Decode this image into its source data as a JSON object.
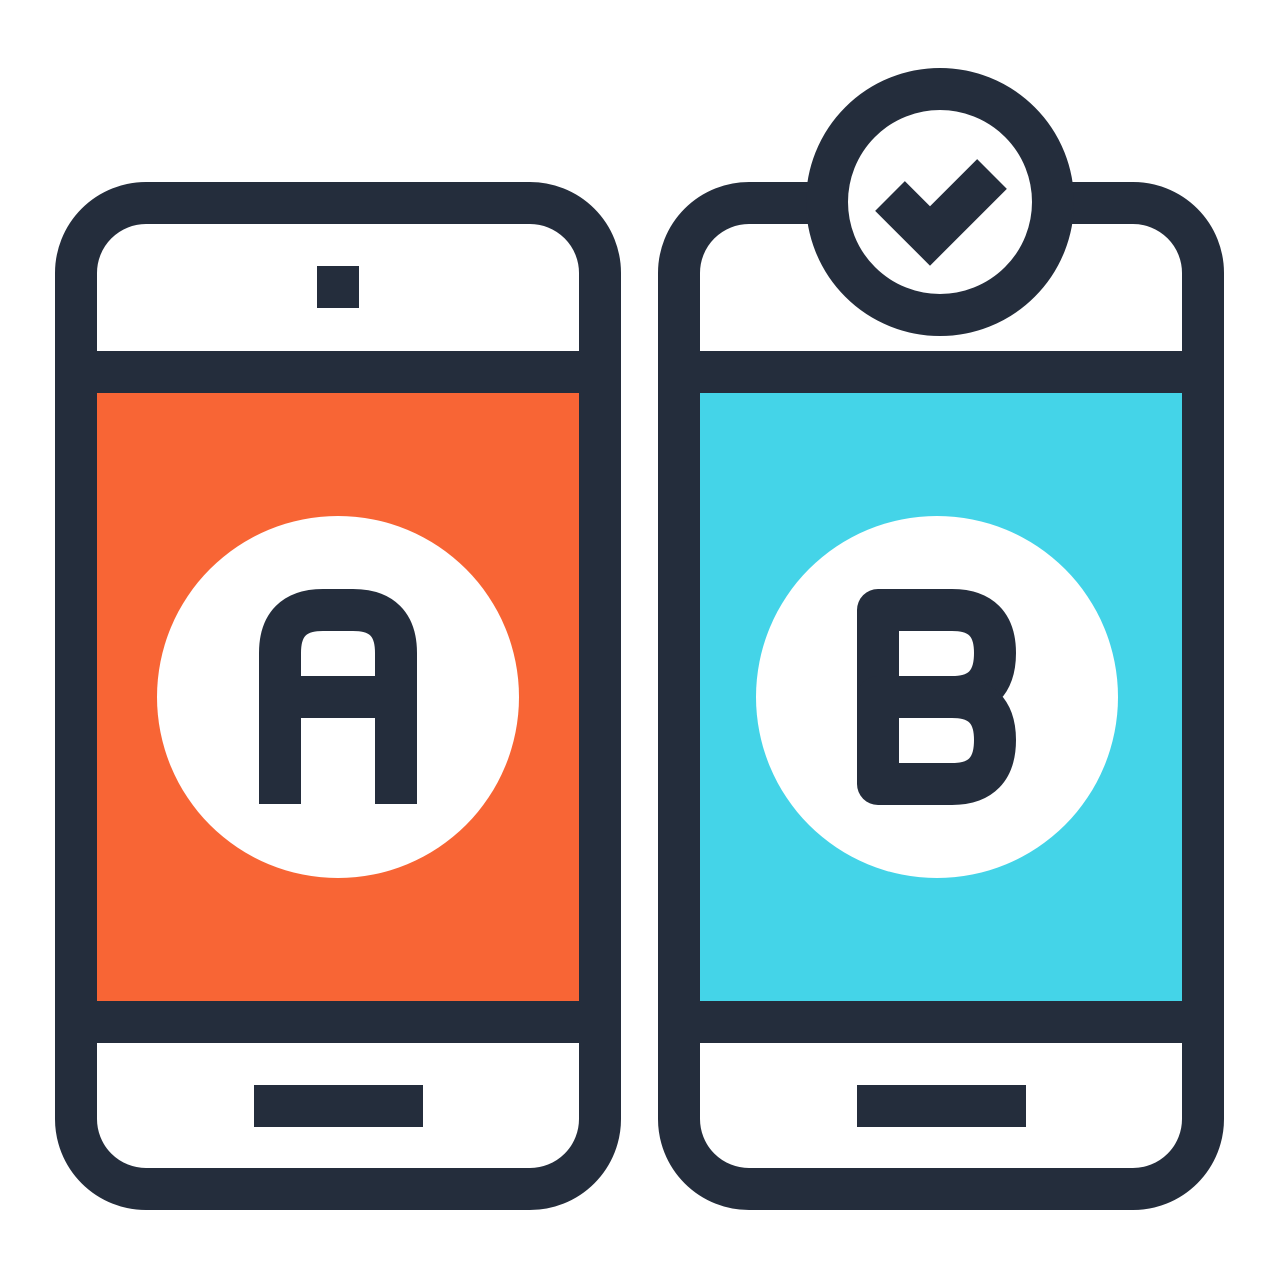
{
  "colors": {
    "outline": "#242d3c",
    "background": "#ffffff",
    "variant_a_screen": "#f86535",
    "variant_b_screen": "#44d4e8",
    "badge_fill": "#ffffff"
  },
  "phones": [
    {
      "variant_letter": "A",
      "screen_color_key": "variant_a_screen",
      "selected": false,
      "top_element": "camera-slot",
      "bottom_element": "home-bar"
    },
    {
      "variant_letter": "B",
      "screen_color_key": "variant_b_screen",
      "selected": true,
      "top_element": "checkmark-badge",
      "bottom_element": "home-bar"
    }
  ],
  "icons": {
    "letter_a": "letter-a-icon",
    "letter_b": "letter-b-icon",
    "selected_badge": "checkmark-icon"
  }
}
